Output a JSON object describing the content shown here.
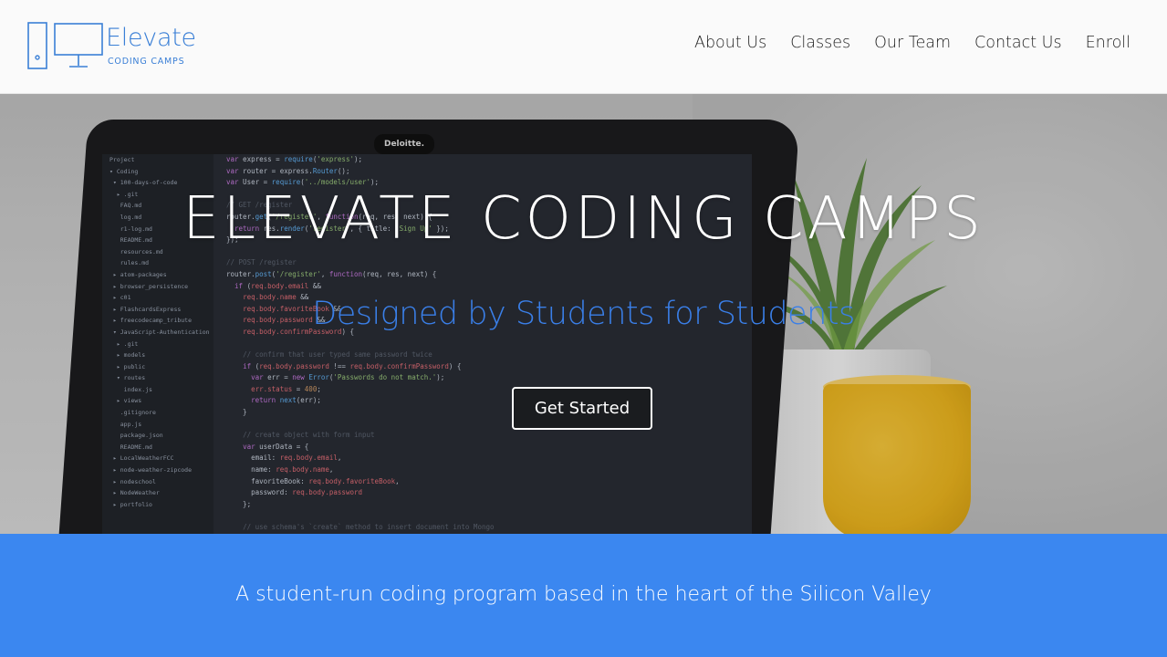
{
  "brand": {
    "name": "Elevate",
    "tagline": "CODING CAMPS",
    "accent_color": "#3a7fd6",
    "logo_icon": "computer-tower-monitor-icon"
  },
  "nav": {
    "items": [
      {
        "label": "About Us"
      },
      {
        "label": "Classes"
      },
      {
        "label": "Our Team"
      },
      {
        "label": "Contact Us"
      },
      {
        "label": "Enroll"
      }
    ]
  },
  "hero": {
    "title": "ELEVATE CODING CAMPS",
    "subtitle": "Designed by Students for Students",
    "subtitle_color": "#3a7fe8",
    "cta_label": "Get Started",
    "laptop_brand": "Deloitte."
  },
  "band": {
    "text": "A student-run coding program based in the heart of the Silicon Valley",
    "color": "#3b87f0"
  }
}
